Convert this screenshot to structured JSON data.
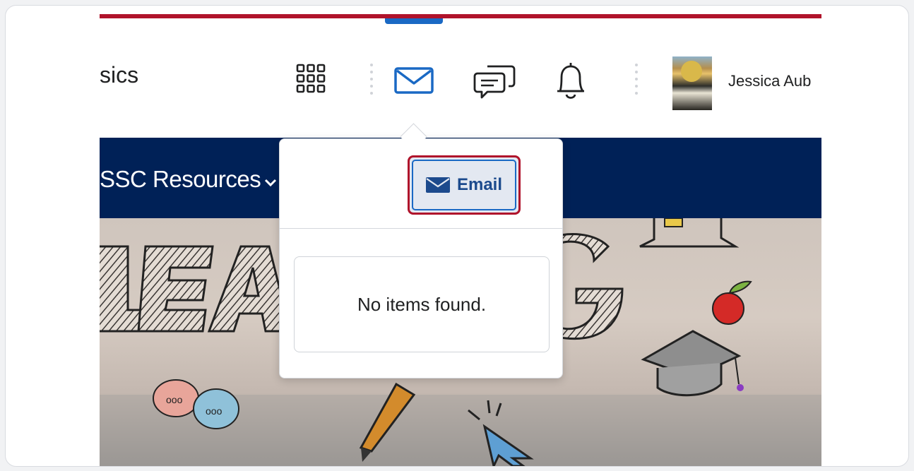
{
  "header": {
    "course_title": "sics",
    "user_name": "Jessica Aub",
    "icons": {
      "waffle": "course-selector-icon",
      "mail": "mail-icon",
      "chat": "chat-icon",
      "bell": "notification-bell-icon",
      "avatar": "user-avatar"
    }
  },
  "navbar": {
    "resources_label": "SSC Resources"
  },
  "banner": {
    "visible_text": "LEA  G"
  },
  "mail_popover": {
    "email_button_label": "Email",
    "empty_message": "No items found."
  },
  "colors": {
    "accent_red": "#b0132b",
    "nav_blue": "#002157",
    "link_blue": "#1a69c4",
    "email_text": "#1c4a8d"
  }
}
